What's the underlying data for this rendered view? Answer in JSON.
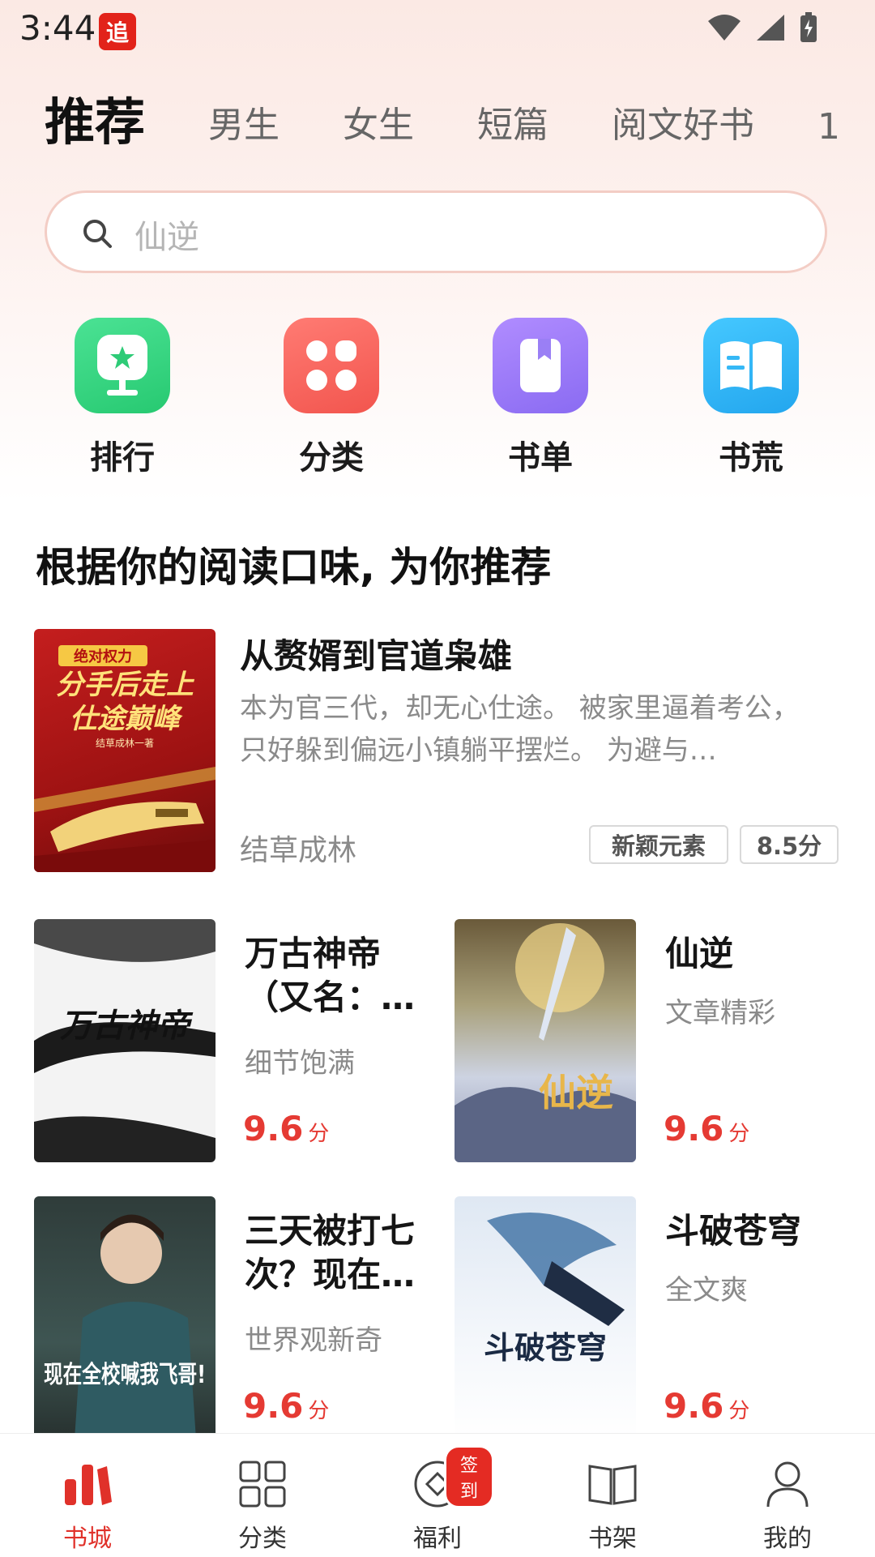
{
  "status_bar": {
    "time": "3:44",
    "app_badge": "追"
  },
  "tabs": [
    {
      "label": "推荐",
      "active": true
    },
    {
      "label": "男生"
    },
    {
      "label": "女生"
    },
    {
      "label": "短篇"
    },
    {
      "label": "阅文好书"
    },
    {
      "label": "1"
    }
  ],
  "search": {
    "placeholder": "仙逆"
  },
  "shortcuts": [
    {
      "label": "排行",
      "icon": "trophy-icon",
      "color": "#3fd783"
    },
    {
      "label": "分类",
      "icon": "category-grid-icon",
      "color": "#f86a63"
    },
    {
      "label": "书单",
      "icon": "booklist-icon",
      "color": "#9a7ff5"
    },
    {
      "label": "书荒",
      "icon": "open-book-icon",
      "color": "#35b8f6"
    }
  ],
  "section": {
    "title": "根据你的阅读口味, 为你推荐"
  },
  "featured": {
    "title": "从赘婿到官道枭雄",
    "desc": "本为官三代，却无心仕途。 被家里逼着考公，只好躲到偏远小镇躺平摆烂。 为避与…",
    "author": "结草成林",
    "tags": [
      "新颖元素",
      "8.5分"
    ],
    "cover_text": [
      "绝对权力",
      "分手后走上",
      "仕途巅峰",
      "结草成林一著"
    ]
  },
  "books": [
    {
      "title": "万古神帝（又名：…",
      "desc": "细节饱满",
      "score": "9.6",
      "unit": "分",
      "cover_text": "万古神帝"
    },
    {
      "title": "仙逆",
      "desc": "文章精彩",
      "score": "9.6",
      "unit": "分",
      "cover_text": "仙逆"
    },
    {
      "title": "三天被打七次？现在…",
      "desc": "世界观新奇",
      "score": "9.6",
      "unit": "分",
      "cover_text": "现在全校喊我飞哥!"
    },
    {
      "title": "斗破苍穹",
      "desc": "全文爽",
      "score": "9.6",
      "unit": "分",
      "cover_text": "斗破苍穹"
    }
  ],
  "bottom_nav": [
    {
      "label": "书城",
      "icon": "bookstore-icon",
      "active": true
    },
    {
      "label": "分类",
      "icon": "category-icon"
    },
    {
      "label": "福利",
      "icon": "welfare-icon",
      "badge": "签到"
    },
    {
      "label": "书架",
      "icon": "bookshelf-icon"
    },
    {
      "label": "我的",
      "icon": "profile-icon"
    }
  ],
  "colors": {
    "accent": "#e0312a",
    "score": "#e53a33"
  }
}
